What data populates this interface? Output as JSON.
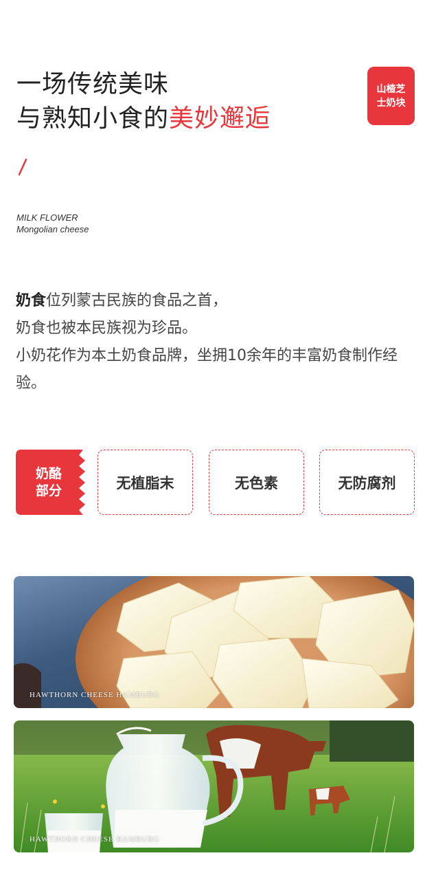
{
  "headline": {
    "line1": "一场传统美味",
    "line2_prefix": "与熟知小食的",
    "line2_accent": "美妙邂逅"
  },
  "tag": {
    "line1": "山楂芝",
    "line2": "士奶块"
  },
  "en_subtitle": {
    "line1": "MILK FLOWER",
    "line2": "Mongolian cheese"
  },
  "intro": {
    "bold": "奶食",
    "line1_rest": "位列蒙古民族的食品之首，",
    "line2": "奶食也被本民族视为珍品。",
    "line3": "小奶花作为本土奶食品牌，坐拥10余年的丰富奶食制作经验。"
  },
  "badge": {
    "line1": "奶酪",
    "line2": "部分"
  },
  "features": [
    "无植脂末",
    "无色素",
    "无防腐剂"
  ],
  "photos": [
    {
      "caption": "HAWTHORN CHEESE HAMBURG"
    },
    {
      "caption": "HAWTHORN CHEESE HAMBURG"
    }
  ],
  "colors": {
    "accent": "#e8373c",
    "text": "#333333"
  }
}
